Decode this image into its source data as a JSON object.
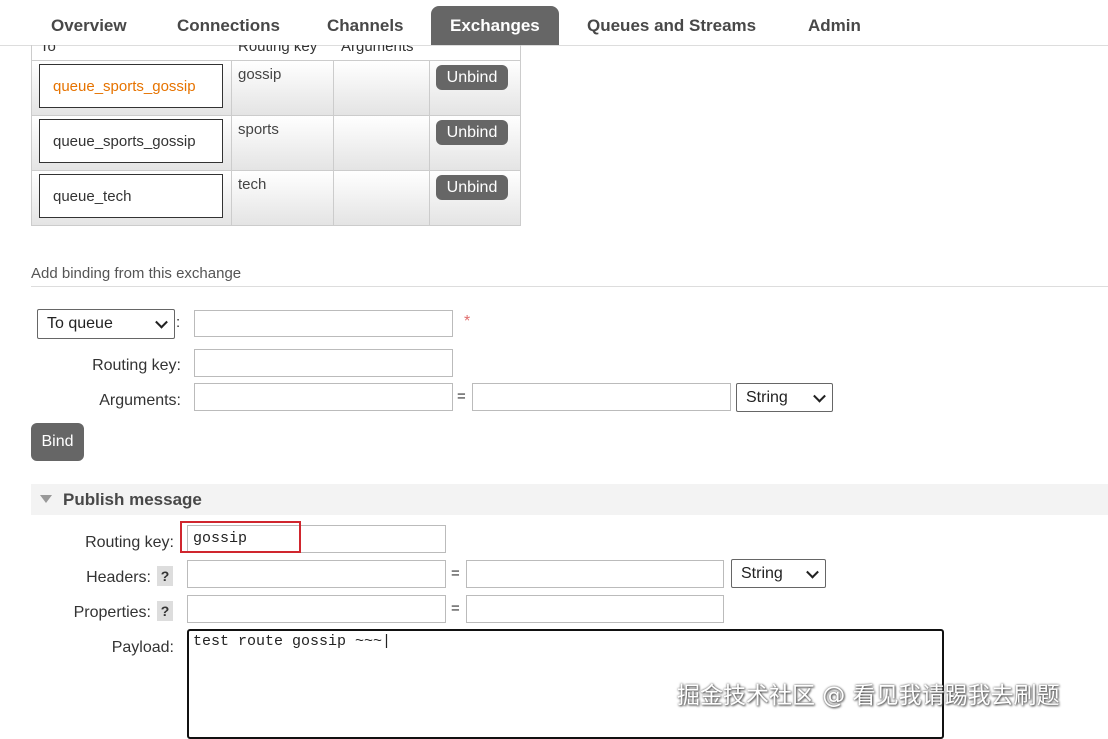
{
  "nav": {
    "tabs": [
      "Overview",
      "Connections",
      "Channels",
      "Exchanges",
      "Queues and Streams",
      "Admin"
    ],
    "active": "Exchanges"
  },
  "bindings": {
    "headers": {
      "to": "To",
      "routing_key": "Routing key",
      "arguments": "Arguments"
    },
    "rows": [
      {
        "to": "queue_sports_gossip",
        "routing_key": "gossip",
        "arguments": "",
        "action": "Unbind"
      },
      {
        "to": "queue_sports_gossip",
        "routing_key": "sports",
        "arguments": "",
        "action": "Unbind"
      },
      {
        "to": "queue_tech",
        "routing_key": "tech",
        "arguments": "",
        "action": "Unbind"
      }
    ]
  },
  "add_binding": {
    "title": "Add binding from this exchange",
    "destination_type": "To queue",
    "destination_value": "",
    "required_mark": "*",
    "routing_key_label": "Routing key:",
    "routing_key_value": "",
    "arguments_label": "Arguments:",
    "arguments_key": "",
    "arguments_value": "",
    "arguments_type": "String",
    "bind_label": "Bind"
  },
  "publish": {
    "title": "Publish message",
    "routing_key_label": "Routing key:",
    "routing_key_value": "gossip",
    "headers_label": "Headers:",
    "headers_type": "String",
    "properties_label": "Properties:",
    "help": "?",
    "payload_label": "Payload:",
    "payload_value": "test route gossip ~~~|"
  },
  "colon": ":",
  "equals": "=",
  "watermark": "掘金技术社区 @ 看见我请踢我去刷题"
}
